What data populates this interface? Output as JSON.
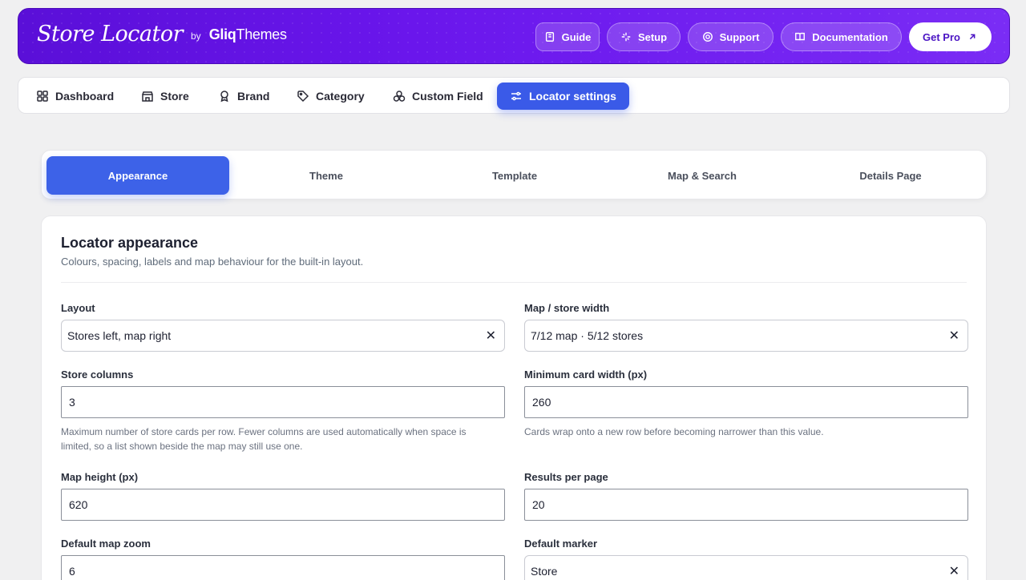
{
  "header": {
    "brand_name": "Store Locator",
    "brand_by": "by",
    "brand_vendor_a": "Gliq",
    "brand_vendor_b": "Themes",
    "buttons": {
      "guide": "Guide",
      "setup": "Setup",
      "support": "Support",
      "documentation": "Documentation",
      "get_pro": "Get Pro"
    }
  },
  "nav": {
    "dashboard": "Dashboard",
    "store": "Store",
    "brand": "Brand",
    "category": "Category",
    "custom_field": "Custom Field",
    "locator_settings": "Locator settings"
  },
  "tabs": {
    "appearance": "Appearance",
    "theme": "Theme",
    "template": "Template",
    "map_search": "Map & Search",
    "details_page": "Details Page"
  },
  "card": {
    "title": "Locator appearance",
    "subtitle": "Colours, spacing, labels and map behaviour for the built-in layout."
  },
  "fields": {
    "layout": {
      "label": "Layout",
      "value": "Stores left, map right"
    },
    "map_store_width": {
      "label": "Map / store width",
      "value": "7/12 map · 5/12 stores"
    },
    "store_columns": {
      "label": "Store columns",
      "value": "3",
      "help_line1": "Maximum number of store cards per row. Fewer columns are used automatically when space is",
      "help_line2": "limited, so a list shown beside the map may still use one."
    },
    "min_card_width": {
      "label": "Minimum card width (px)",
      "value": "260",
      "help": "Cards wrap onto a new row before becoming narrower than this value."
    },
    "map_height": {
      "label": "Map height (px)",
      "value": "620"
    },
    "results_per_page": {
      "label": "Results per page",
      "value": "20"
    },
    "default_map_zoom": {
      "label": "Default map zoom",
      "value": "6"
    },
    "default_marker": {
      "label": "Default marker",
      "value": "Store"
    }
  },
  "clear_glyph": "✕"
}
